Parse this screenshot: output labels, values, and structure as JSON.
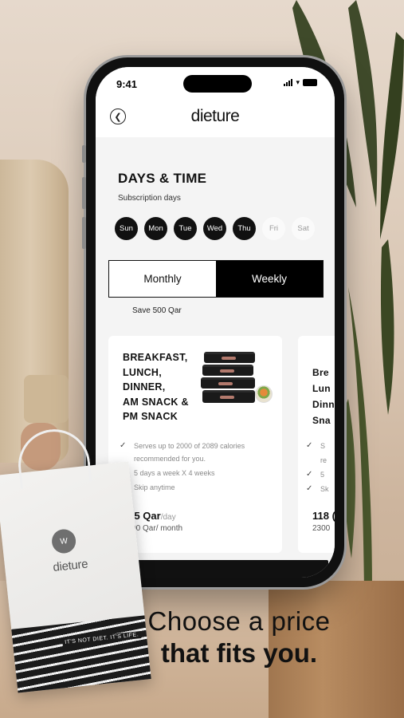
{
  "status": {
    "time": "9:41"
  },
  "header": {
    "logo": "dieture",
    "back_icon": "chevron-left-icon"
  },
  "days_section": {
    "title": "DAYS & TIME",
    "subtitle": "Subscription days",
    "days": [
      {
        "label": "Sun",
        "selected": true
      },
      {
        "label": "Mon",
        "selected": true
      },
      {
        "label": "Tue",
        "selected": true
      },
      {
        "label": "Wed",
        "selected": true
      },
      {
        "label": "Thu",
        "selected": true
      },
      {
        "label": "Fri",
        "selected": false
      },
      {
        "label": "Sat",
        "selected": false
      }
    ]
  },
  "plan_toggle": {
    "monthly": "Monthly",
    "weekly": "Weekly",
    "active": "monthly",
    "save_note": "Save 500 Qar"
  },
  "cards": [
    {
      "title_lines": [
        "BREAKFAST,",
        "LUNCH,",
        "DINNER,",
        "AM SNACK &",
        "PM SNACK"
      ],
      "features": [
        "Serves up to 2000 of 2089 calories recommended for you.",
        "5 days a week X 4 weeks",
        "Skip anytime"
      ],
      "price": "125 Qar",
      "price_unit": "/day",
      "price_sub": "2500 Qar/ month"
    },
    {
      "title_lines": [
        "Bre",
        "Lun",
        "Dinn",
        "Sna"
      ],
      "features": [
        "S",
        "re",
        "5",
        "Sk"
      ],
      "price": "118 (",
      "price_sub": "2300"
    }
  ],
  "bag": {
    "logo_mark": "W",
    "logo_text": "dieture",
    "band_text": "IT'S NOT DIET. IT'S LIFE."
  },
  "caption": {
    "line1": "Choose a price",
    "line2": "that fits you."
  },
  "colors": {
    "accent": "#111111",
    "background": "#f4f4f4",
    "card": "#ffffff",
    "muted_text": "#8a8a8a"
  }
}
